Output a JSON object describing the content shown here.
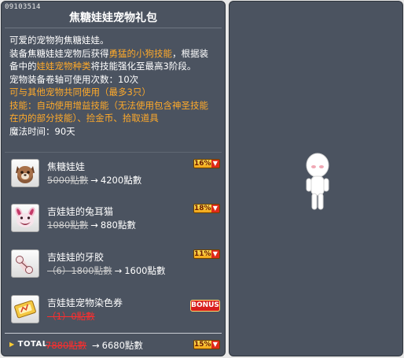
{
  "package": {
    "id": "09103514",
    "title": "焦糖娃娃宠物礼包"
  },
  "description": {
    "line1": "可爱的宠物狗焦糖娃娃。",
    "line2a": "装备焦糖娃娃宠物后获得",
    "line2b": "勇猛的小狗技能",
    "line2c": "，根据装",
    "line3a": "备中的",
    "line3b": "娃娃宠物种类",
    "line3c": "将技能强化至最高3阶段。",
    "line4": "宠物装备卷轴可使用次数：10次",
    "line5": "可与其他宠物共同使用（最多3只）",
    "line6": "技能：自动使用增益技能（无法使用包含神圣技能",
    "line7": "在内的部分技能）、捡金币、拾取道具",
    "line8": "魔法时间：90天"
  },
  "items": [
    {
      "name": "焦糖娃娃",
      "old_price": "5000點數",
      "arrow": "→",
      "new_price": "4200點數",
      "discount": "16%",
      "icon": "caramel-doll-pet-icon"
    },
    {
      "name": "吉娃娃的兔耳猫",
      "old_price": "1080點數",
      "arrow": "→",
      "new_price": "880點數",
      "discount": "18%",
      "icon": "bunny-ear-cat-icon"
    },
    {
      "name": "吉娃娃的牙胶",
      "old_price": "（6）1800點數",
      "arrow": "→",
      "new_price": "1600點數",
      "discount": "11%",
      "icon": "teething-toy-icon"
    },
    {
      "name": "吉娃娃宠物染色券",
      "old_price": "（1）0點數",
      "badge": "BONUS",
      "icon": "pet-dye-coupon-icon"
    }
  ],
  "total": {
    "label": "TOTAL",
    "old_price": "7880點數",
    "arrow": "→",
    "new_price": "6680點數",
    "discount": "15%"
  },
  "icons": {
    "down_arrow": "down-arrow-icon",
    "bullet": "triangle-bullet-icon"
  },
  "colors": {
    "panel_bg": "#4b5360",
    "highlight_orange": "#ffaa2a",
    "price_strike_red": "#ff2d2d",
    "badge_red": "#d81e1e"
  }
}
